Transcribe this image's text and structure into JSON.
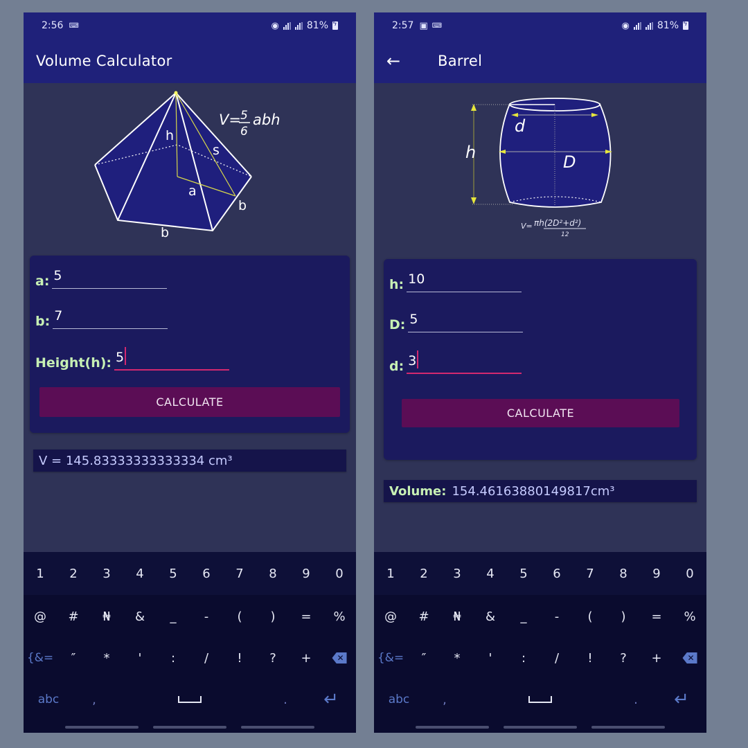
{
  "colors": {
    "appbar": "#1f217a",
    "background": "#2f3357",
    "card": "#1b1a5e",
    "label_green": "#c7f0b4",
    "accent_pink": "#d3296f",
    "button": "#5b0d55",
    "keyboard": "#0a0b2e",
    "figure_fill": "#1f1f7d",
    "dimension_yellow": "#e6e63c"
  },
  "screens": [
    {
      "status": {
        "time": "2:56",
        "icons": [
          "keyboard-icon"
        ],
        "battery": "81%"
      },
      "appbar": {
        "title": "Volume Calculator",
        "has_back": false
      },
      "figure": {
        "name": "pentagonal-pyramid",
        "formula": {
          "prefix": "V=",
          "numerator": "5",
          "denominator": "6",
          "suffix": "abh"
        },
        "labels": {
          "h": "h",
          "s": "s",
          "a": "a",
          "b1": "b",
          "b2": "b"
        }
      },
      "fields": [
        {
          "label": "a:",
          "value": "5",
          "focused": false
        },
        {
          "label": "b:",
          "value": "7",
          "focused": false
        },
        {
          "label": "Height(h):",
          "value": "5",
          "focused": true
        }
      ],
      "button": "CALCULATE",
      "result": {
        "label": "",
        "text": "V = 145.83333333333334 cm³"
      }
    },
    {
      "status": {
        "time": "2:57",
        "icons": [
          "image-icon",
          "keyboard-icon"
        ],
        "battery": "81%"
      },
      "appbar": {
        "title": "Barrel",
        "has_back": true
      },
      "figure": {
        "name": "barrel",
        "formula": {
          "prefix": "V=",
          "numerator": "πh(2D²+d²)",
          "denominator": "12"
        },
        "labels": {
          "h": "h",
          "d": "d",
          "D": "D"
        }
      },
      "fields": [
        {
          "label": "h:",
          "value": "10",
          "focused": false
        },
        {
          "label": "D:",
          "value": "5",
          "focused": false
        },
        {
          "label": "d:",
          "value": "3",
          "focused": true
        }
      ],
      "button": "CALCULATE",
      "result": {
        "label": "Volume:",
        "text": "154.46163880149817cm³"
      }
    }
  ],
  "keyboard": {
    "row1": [
      "1",
      "2",
      "3",
      "4",
      "5",
      "6",
      "7",
      "8",
      "9",
      "0"
    ],
    "row2": [
      "@",
      "#",
      "₦",
      "&",
      "_",
      "-",
      "(",
      ")",
      "=",
      "%"
    ],
    "row3": [
      "{&=",
      "″",
      "*",
      "'",
      ":",
      "/",
      "!",
      "?",
      "+",
      "⌫"
    ],
    "row4": [
      "abc",
      ",",
      "␣",
      ".",
      "↵"
    ]
  }
}
